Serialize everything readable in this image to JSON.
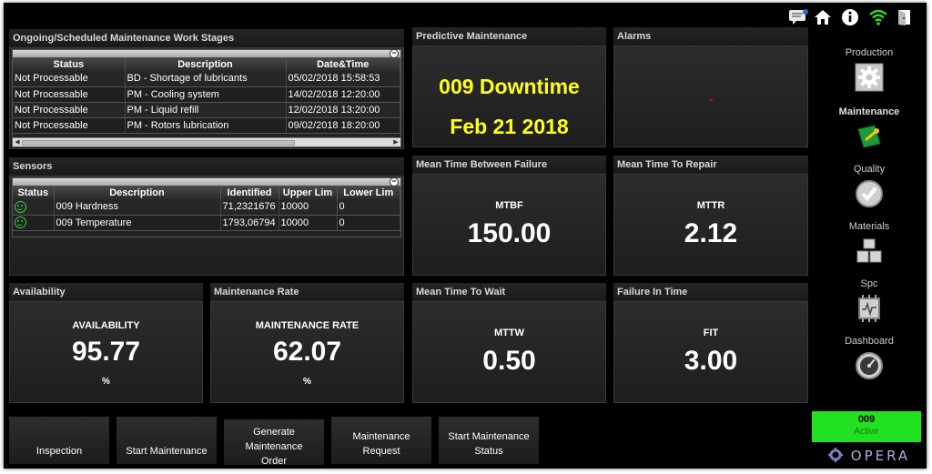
{
  "colors": {
    "highlight_yellow": "#ffff1a",
    "status_green": "#22e022",
    "alarm_red": "#e00000",
    "smiley_green": "#3fd23f"
  },
  "work_stages": {
    "title": "Ongoing/Scheduled Maintenance Work Stages",
    "columns": [
      "Status",
      "Description",
      "Date&Time"
    ],
    "rows": [
      [
        "Not Processable",
        "BD - Shortage of lubricants",
        "05/02/2018 15:58:53"
      ],
      [
        "Not Processable",
        "PM - Cooling system",
        "14/02/2018 12:20:00"
      ],
      [
        "Not Processable",
        "PM - Liquid refill",
        "12/02/2018 13:20:00"
      ],
      [
        "Not Processable",
        "PM - Rotors lubrication",
        "09/02/2018 18:20:00"
      ]
    ]
  },
  "sensors": {
    "title": "Sensors",
    "columns": [
      "Status",
      "Description",
      "Identified",
      "Upper Lim",
      "Lower Lim"
    ],
    "rows": [
      {
        "status_icon": "smiley-icon",
        "description": "009 Hardness",
        "identified": "71,2321676",
        "upper": "10000",
        "lower": "0"
      },
      {
        "status_icon": "smiley-icon",
        "description": "009 Temperature",
        "identified": "1793,06794",
        "upper": "10000",
        "lower": "0"
      }
    ]
  },
  "predictive": {
    "title": "Predictive Maintenance",
    "line1": "009 Downtime",
    "line2": "Feb 21 2018"
  },
  "alarms": {
    "title": "Alarms",
    "value": "-"
  },
  "mtbf": {
    "title": "Mean Time Between Failure",
    "label": "MTBF",
    "value": "150.00"
  },
  "mttr": {
    "title": "Mean Time To Repair",
    "label": "MTTR",
    "value": "2.12"
  },
  "availability": {
    "title": "Availability",
    "label": "AVAILABILITY",
    "value": "95.77",
    "unit": "%"
  },
  "maintenance_rate": {
    "title": "Maintenance Rate",
    "label": "MAINTENANCE RATE",
    "value": "62.07",
    "unit": "%"
  },
  "mttw": {
    "title": "Mean Time To Wait",
    "label": "MTTW",
    "value": "0.50"
  },
  "fit": {
    "title": "Failure In Time",
    "label": "FIT",
    "value": "3.00"
  },
  "actions": {
    "inspection": "Inspection",
    "start_maintenance": "Start Maintenance",
    "generate_order": [
      "Generate",
      "Maintenance",
      "Order"
    ],
    "request": [
      "Maintenance",
      "Request"
    ],
    "status": [
      "Start Maintenance",
      "Status"
    ]
  },
  "sidebar": {
    "items": [
      {
        "label": "Production",
        "icon": "gear-icon"
      },
      {
        "label": "Maintenance",
        "icon": "wrench-icon",
        "active": true
      },
      {
        "label": "Quality",
        "icon": "check-icon"
      },
      {
        "label": "Materials",
        "icon": "boxes-icon"
      },
      {
        "label": "Spc",
        "icon": "chip-icon"
      },
      {
        "label": "Dashboard",
        "icon": "gauge-icon"
      }
    ]
  },
  "topbar": {
    "icons": [
      "message-icon",
      "home-icon",
      "info-icon",
      "wifi-icon",
      "exit-icon"
    ]
  },
  "status": {
    "id": "009",
    "text": "Active"
  },
  "logo": "OPERA"
}
